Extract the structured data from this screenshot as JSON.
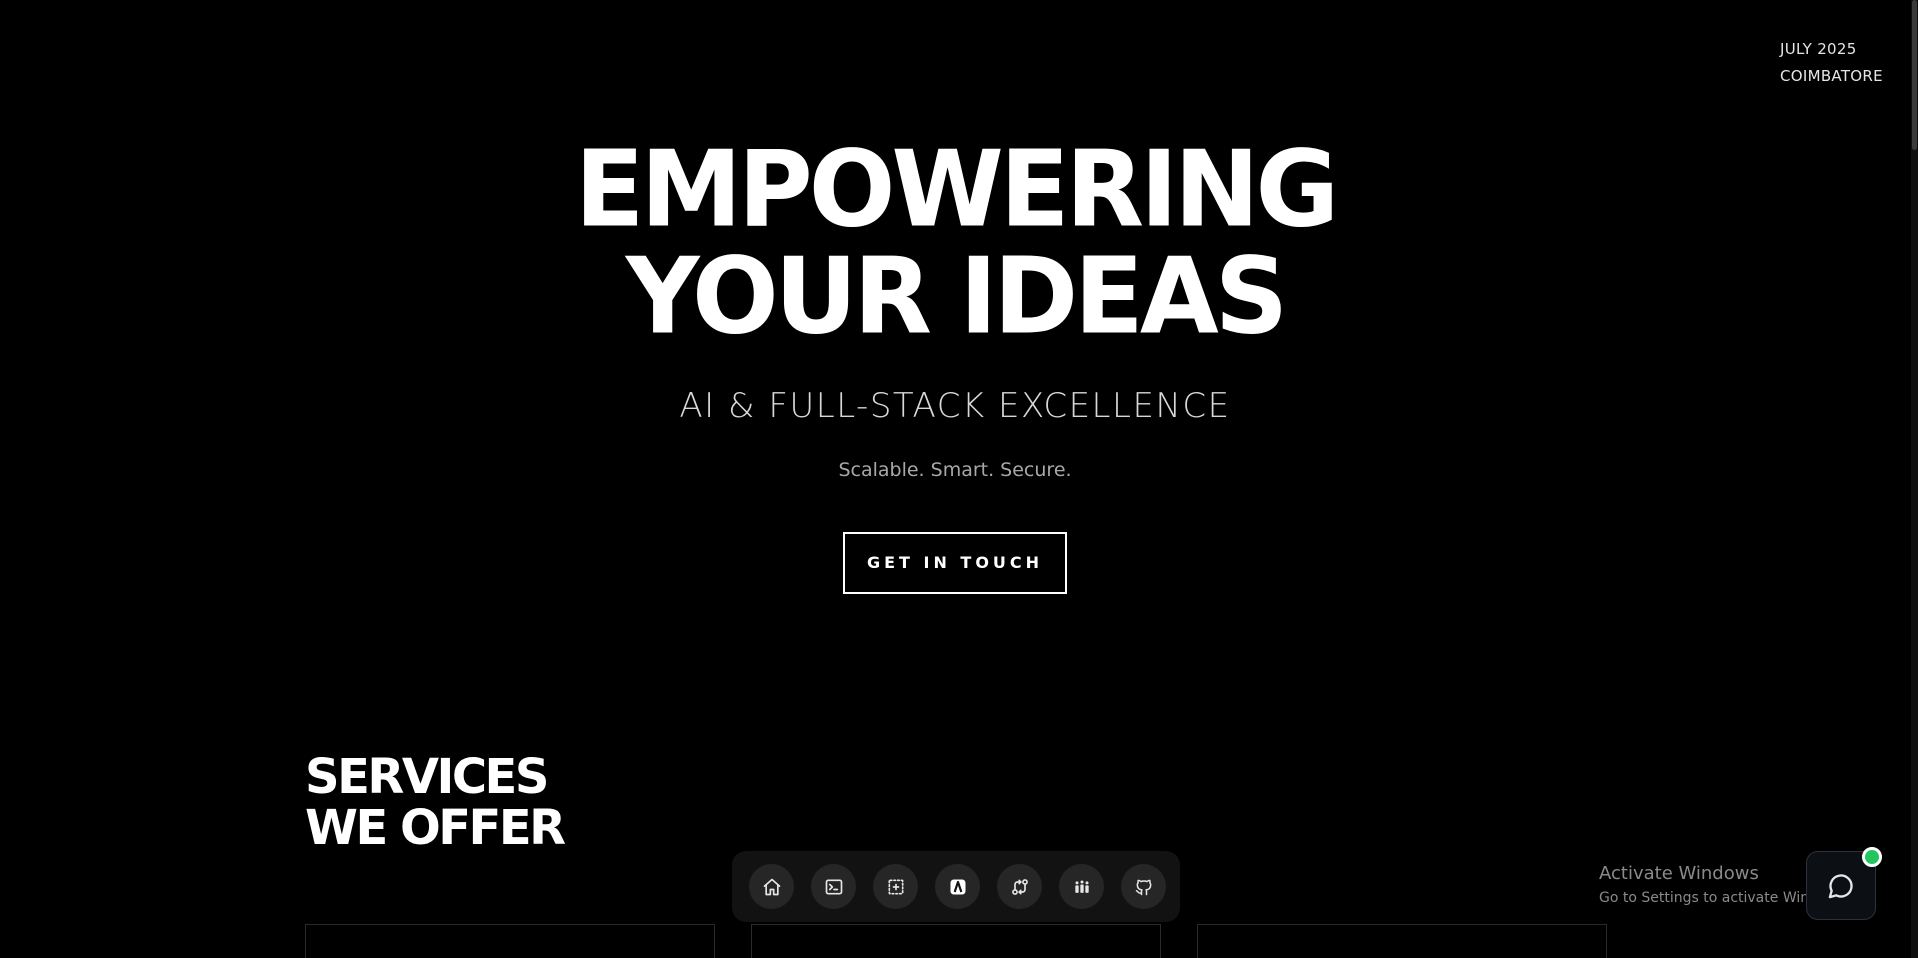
{
  "meta": {
    "date": "JULY 2025",
    "location": "COIMBATORE"
  },
  "hero": {
    "title_line1": "EMPOWERING",
    "title_line2": "YOUR IDEAS",
    "subtitle": "AI & FULL-STACK EXCELLENCE",
    "tagline": "Scalable. Smart. Secure.",
    "cta_label": "GET IN TOUCH"
  },
  "services": {
    "heading_line1": "SERVICES",
    "heading_line2": "WE OFFER"
  },
  "dock": {
    "items": [
      {
        "icon": "home-icon",
        "active": false
      },
      {
        "icon": "terminal-icon",
        "active": false
      },
      {
        "icon": "focus-add-icon",
        "active": false
      },
      {
        "icon": "brand-logo-icon",
        "active": true
      },
      {
        "icon": "git-compare-icon",
        "active": false
      },
      {
        "icon": "team-icon",
        "active": false
      },
      {
        "icon": "github-icon",
        "active": false
      }
    ]
  },
  "watermark": {
    "title": "Activate Windows",
    "subtitle": "Go to Settings to activate Windows."
  },
  "colors": {
    "background": "#000000",
    "text": "#ffffff",
    "muted": "#a8a8a8",
    "dock": "#121212",
    "online": "#22c55e"
  }
}
